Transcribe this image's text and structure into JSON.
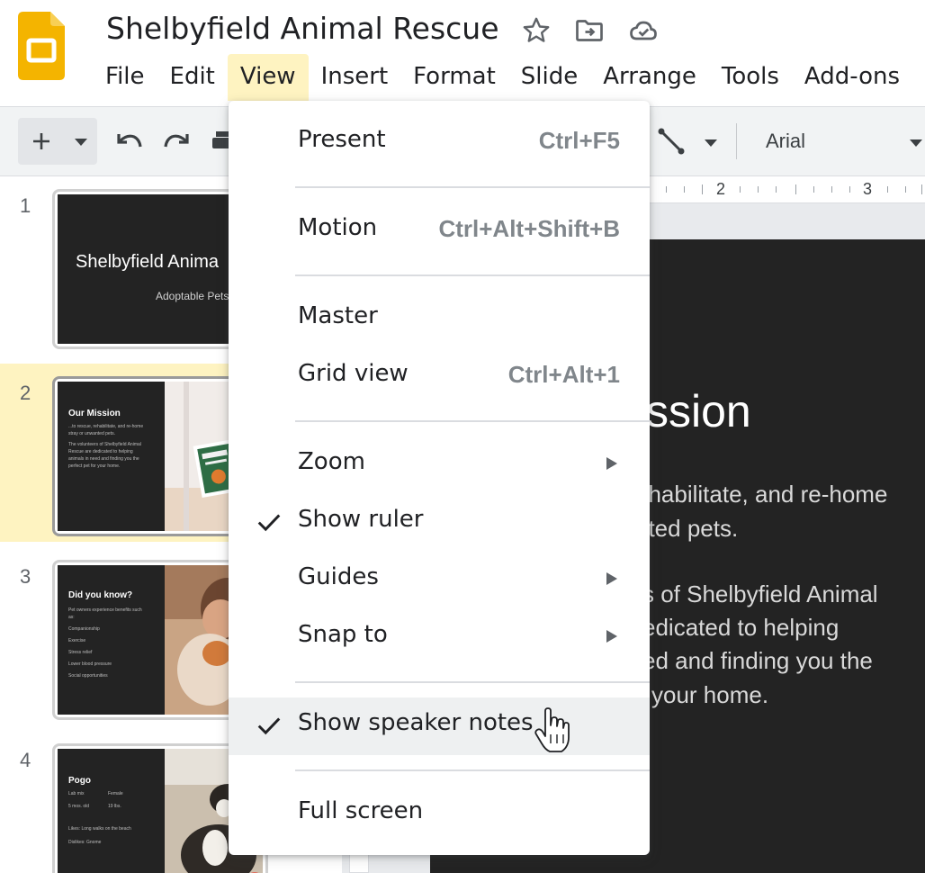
{
  "app": {
    "document_title": "Shelbyfield Animal Rescue",
    "icons": [
      "slides-logo-icon",
      "star-icon",
      "move-to-folder-icon",
      "cloud-saved-icon"
    ]
  },
  "menubar": {
    "items": [
      "File",
      "Edit",
      "View",
      "Insert",
      "Format",
      "Slide",
      "Arrange",
      "Tools",
      "Add-ons"
    ],
    "active": "View"
  },
  "toolbar": {
    "icons": [
      "add-icon",
      "dropdown-arrow-icon",
      "undo-icon",
      "redo-icon",
      "print-icon",
      "line-icon",
      "dropdown-arrow-icon",
      "font-dropdown-arrow-icon"
    ],
    "font": "Arial"
  },
  "ruler": {
    "labels": [
      "2",
      "3"
    ]
  },
  "filmstrip": {
    "selected_index": 2,
    "slides": [
      {
        "number": "1",
        "title": "Shelbyfield Anima",
        "subtitle": "Adoptable Pets"
      },
      {
        "number": "2",
        "title": "Our Mission",
        "lines": [
          "...to rescue, rehabilitate, and re-home",
          "stray or unwanted pets.",
          "The volunteers of Shelbyfield Animal",
          "Rescue are dedicated to helping",
          "animals in need and finding you the",
          "perfect pet for your home."
        ]
      },
      {
        "number": "3",
        "title": "Did you know?",
        "lines": [
          "Pet owners experience benefits such",
          "as:",
          "Companionship",
          "Exercise",
          "Stress relief",
          "Lower blood pressure",
          "Social opportunities"
        ]
      },
      {
        "number": "4",
        "title": "Pogo",
        "lines": [
          "Lab mix",
          "Female",
          "5 mos. old",
          "19 lbs.",
          "Likes: Long walks on the beach",
          "Dislikes: Gnome"
        ]
      }
    ]
  },
  "main_slide": {
    "title_visible": "ssion",
    "lines": [
      "ehabilitate, and re-home",
      "nted pets.",
      "s of Shelbyfield Animal",
      "edicated to helping",
      "ed and finding you the",
      "your home."
    ]
  },
  "view_menu": {
    "items": [
      {
        "label": "Present",
        "shortcut": "Ctrl+F5"
      },
      {
        "label": "Motion",
        "shortcut": "Ctrl+Alt+Shift+B"
      },
      {
        "label": "Master",
        "shortcut": ""
      },
      {
        "label": "Grid view",
        "shortcut": "Ctrl+Alt+1"
      },
      {
        "label": "Zoom",
        "submenu": true
      },
      {
        "label": "Show ruler",
        "checked": true
      },
      {
        "label": "Guides",
        "submenu": true
      },
      {
        "label": "Snap to",
        "submenu": true
      },
      {
        "label": "Show speaker notes",
        "checked": true,
        "hovered": true
      },
      {
        "label": "Full screen",
        "shortcut": ""
      }
    ]
  },
  "colors": {
    "active_menu_bg": "#fef3c1",
    "selected_slide_bg": "#fef3c1",
    "slides_logo": "#f4b400",
    "slide_bg": "#232323",
    "shortcut_text": "#80868b"
  }
}
